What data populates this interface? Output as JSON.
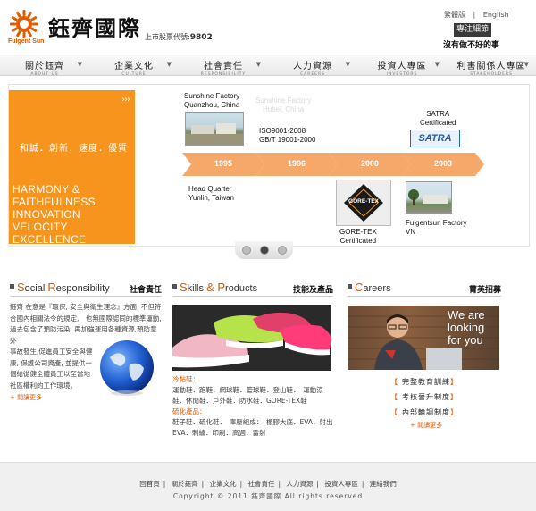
{
  "header": {
    "brand": "鈺齊國際",
    "logo_text": "Fulgent Sun",
    "stock_label": "上市股票代號:",
    "stock_code": "9802",
    "lang_tc": "繁體版",
    "lang_sep": "|",
    "lang_en": "English",
    "focus_button": "專注細節",
    "slogan": "沒有做不好的事"
  },
  "nav": [
    {
      "zh": "關於鈺齊",
      "en": "ABOUT US"
    },
    {
      "zh": "企業文化",
      "en": "CULTURE"
    },
    {
      "zh": "社會責任",
      "en": "RESPONSIBILITY"
    },
    {
      "zh": "人力資源",
      "en": "CAREERS"
    },
    {
      "zh": "投資人專區",
      "en": "INVESTORS"
    },
    {
      "zh": "利害關係人專區",
      "en": "STAKEHOLDERS"
    }
  ],
  "banner": {
    "arrows": "›››",
    "motto_zh": "和誠．創新．速度．優質",
    "motto_en_1": "HARMONY &",
    "motto_en_2": "FAITHFULNESS",
    "motto_en_3": "INNOVATION",
    "motto_en_4": "VELOCITY",
    "motto_en_5": "EXCELLENCE",
    "label_quanzhou_1": "Sunshine Factory",
    "label_quanzhou_2": "Quanzhou, China",
    "label_hubei_1": "Sunshine Factory",
    "label_hubei_2": "Hubei, China",
    "label_iso_1": "ISO9001-2008",
    "label_iso_2": "GB/T 19001-2000",
    "label_satra_1": "SATRA",
    "label_satra_2": "Certificated",
    "satra_logo": "SATRA",
    "years": [
      "1995",
      "1996",
      "2000",
      "2003"
    ],
    "label_hq_1": "Head Quarter",
    "label_hq_2": "Yunlin, Taiwan",
    "label_goretex_1": "GORE-TEX",
    "label_goretex_2": "Certificated",
    "goretex_logo": "GORE-TEX",
    "label_vn_1": "Fulgentsun Factory",
    "label_vn_2": "VN"
  },
  "social": {
    "title_first": "S",
    "title_rest_1": "ocial ",
    "title_second": "R",
    "title_rest_2": "esponsibility",
    "title_zh": "社會責任",
    "lines": [
      "鈺齊 在意是『環保, 安全與衛生理念』方面, 不但符",
      "合國內相關法令的規定,　也無國際認同的標準運動,",
      "過去包含了預防污染, 再加強運用各種資源,預防意外",
      "事故發生,促進員工安全與健",
      "康, 保護公司資產, 並提供一",
      "個給從健全體員工以至當地",
      "社區權利的工作環境。"
    ],
    "more": "+ 閱讀更多"
  },
  "skills": {
    "title_first": "S",
    "title_rest_1": "kills ",
    "title_amp": "&",
    "title_second": " P",
    "title_rest_2": "roducts",
    "title_zh": "技能及產品",
    "cat_1": "冷黏鞋：",
    "items_1a": "運動鞋．跑鞋．網球鞋．籃球鞋．登山鞋．　運動涼",
    "items_1b": "鞋．休閒鞋．戶外鞋．防水鞋．GORE-TEX鞋",
    "cat_2": "硫化產品：",
    "items_2a": "鞋子鞋．硫化鞋．　庫壓組成：　橡膠大底．EVA．射出",
    "items_2b": "EVA．刺繡．印刷．高週．雷射"
  },
  "careers": {
    "title_first": "C",
    "title_rest": "areers",
    "title_zh": "菁英招募",
    "photo_text_1": "We are",
    "photo_text_2": "looking",
    "photo_text_3": "for you",
    "links": [
      "完整教育訓練",
      "考核晉升制度",
      "內部輪調制度"
    ],
    "bracket_open": "【",
    "bracket_close": "】",
    "more": "+ 閱讀更多"
  },
  "footer": {
    "links": [
      "回首頁",
      "關於鈺齊",
      "企業文化",
      "社會責任",
      "人力資源",
      "投資人專區",
      "連絡我們"
    ],
    "sep": "|",
    "copyright": "Copyright © 2011 鈺齊國際 All rights reserved"
  },
  "colors": {
    "orange": "#f7941d",
    "accent": "#e05a00",
    "timeline": "#f5a86a"
  }
}
